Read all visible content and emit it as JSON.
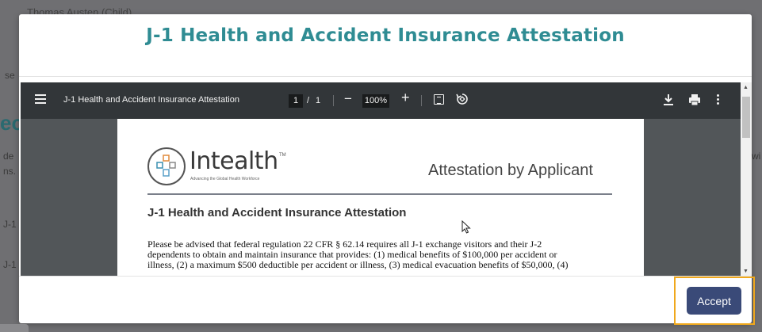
{
  "background": {
    "top_text": "Thomas Austen (Child)",
    "fragments": [
      "se",
      "ec",
      "de",
      "ns.",
      "J-1",
      "J-1",
      "wi"
    ]
  },
  "modal": {
    "title": "J-1 Health and Accident Insurance Attestation",
    "accept_label": "Accept"
  },
  "pdf_toolbar": {
    "menu_icon": "menu-icon",
    "title": "J-1 Health and Accident Insurance Attestation",
    "page_current": "1",
    "page_separator": "/",
    "page_total": "1",
    "zoom_minus": "−",
    "zoom": "100%",
    "zoom_plus": "+",
    "fit_icon": "fit-page-icon",
    "rotate_icon": "rotate-icon",
    "download_icon": "download-icon",
    "print_icon": "print-icon",
    "more_icon": "more-vert-icon"
  },
  "pdf_page": {
    "logo_name": "Intealth",
    "logo_tm": "TM",
    "logo_tagline": "Advancing the Global Health Workforce",
    "heading_right": "Attestation by Applicant",
    "subtitle": "J-1 Health and Accident Insurance Attestation",
    "body_lines": [
      "Please be advised that federal regulation 22 CFR § 62.14 requires all J-1 exchange visitors and their J-2",
      "dependents to obtain and maintain insurance that provides: (1) medical benefits of $100,000 per accident or",
      "illness, (2) a maximum $500 deductible per accident or illness, (3) medical evacuation benefits of $50,000, (4)"
    ]
  },
  "colors": {
    "title": "#2f8c93",
    "toolbar": "#323639",
    "viewer_bg": "#525659",
    "accept_button": "#3a4a78",
    "highlight": "#f0a81c"
  }
}
